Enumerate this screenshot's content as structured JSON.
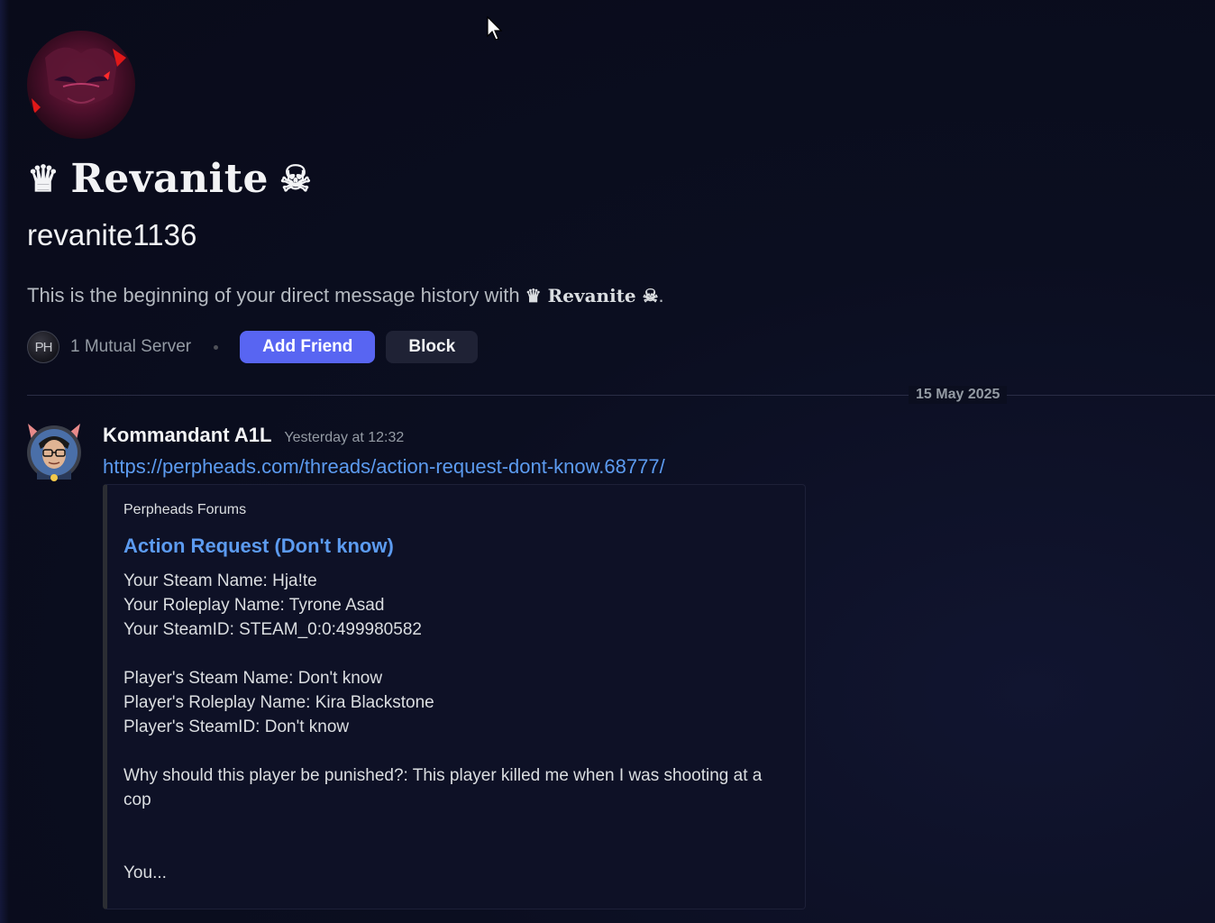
{
  "profile": {
    "display_name": "Revanite",
    "display_name_prefix_icon": "crown-icon",
    "display_name_suffix_icon": "skull-crossbones-icon",
    "username": "revanite1136",
    "intro_text": "This is the beginning of your direct message history with",
    "intro_name": "♛ Revanite ☠",
    "intro_suffix": "."
  },
  "actions": {
    "server_icon_text": "PH",
    "mutual_servers": "1 Mutual Server",
    "add_friend_label": "Add Friend",
    "block_label": "Block"
  },
  "divider": {
    "date": "15 May 2025"
  },
  "message": {
    "author": "Kommandant A1L",
    "timestamp": "Yesterday at 12:32",
    "link": "https://perpheads.com/threads/action-request-dont-know.68777/",
    "embed": {
      "provider": "Perpheads Forums",
      "title": "Action Request (Don't know)",
      "lines": [
        "Your Steam Name: Hja!te",
        "Your Roleplay Name: Tyrone Asad",
        "Your SteamID: STEAM_0:0:499980582",
        "",
        "Player's Steam Name: Don't know",
        "Player's Roleplay Name: Kira Blackstone",
        "Player's SteamID: Don't know",
        "",
        "Why should this player be punished?: This player killed me when I was shooting at a cop",
        "",
        "",
        "You..."
      ]
    }
  },
  "colors": {
    "accent": "#5865f2",
    "link": "#5c9bf0",
    "background": "#0b0e20"
  }
}
